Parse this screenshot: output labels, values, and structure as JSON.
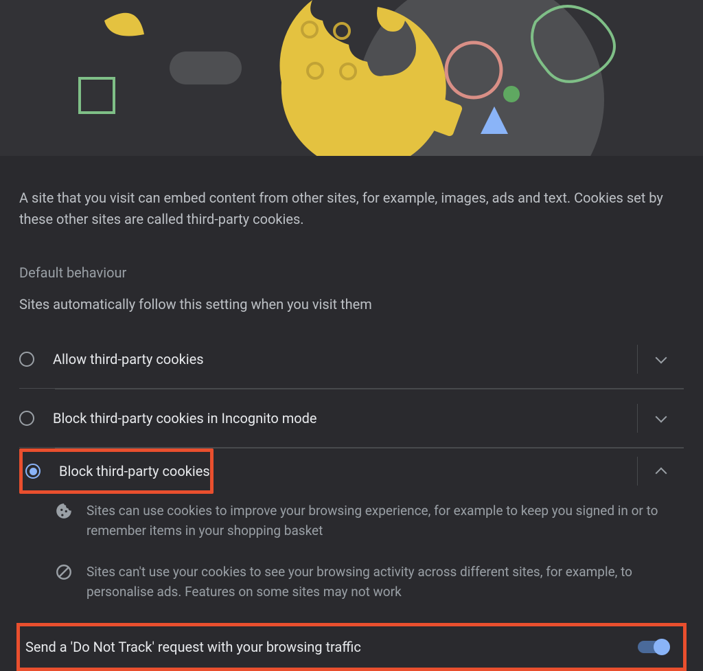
{
  "intro_paragraph": "A site that you visit can embed content from other sites, for example, images, ads and text. Cookies set by these other sites are called third-party cookies.",
  "section": {
    "title": "Default behaviour",
    "subtitle": "Sites automatically follow this setting when you visit them"
  },
  "options": [
    {
      "label": "Allow third-party cookies",
      "selected": false,
      "expanded": false
    },
    {
      "label": "Block third-party cookies in Incognito mode",
      "selected": false,
      "expanded": false
    },
    {
      "label": "Block third-party cookies",
      "selected": true,
      "expanded": true
    }
  ],
  "details": [
    {
      "icon": "cookie-icon",
      "text": "Sites can use cookies to improve your browsing experience, for example to keep you signed in or to remember items in your shopping basket"
    },
    {
      "icon": "block-icon",
      "text": "Sites can't use your cookies to see your browsing activity across different sites, for example, to personalise ads. Features on some sites may not work"
    }
  ],
  "dnt": {
    "label": "Send a 'Do Not Track' request with your browsing traffic",
    "enabled": true
  },
  "colors": {
    "highlight": "#e94f2e",
    "accent": "#8ab4f8",
    "bg": "#2a2a2e",
    "banner_bg": "#323236"
  }
}
